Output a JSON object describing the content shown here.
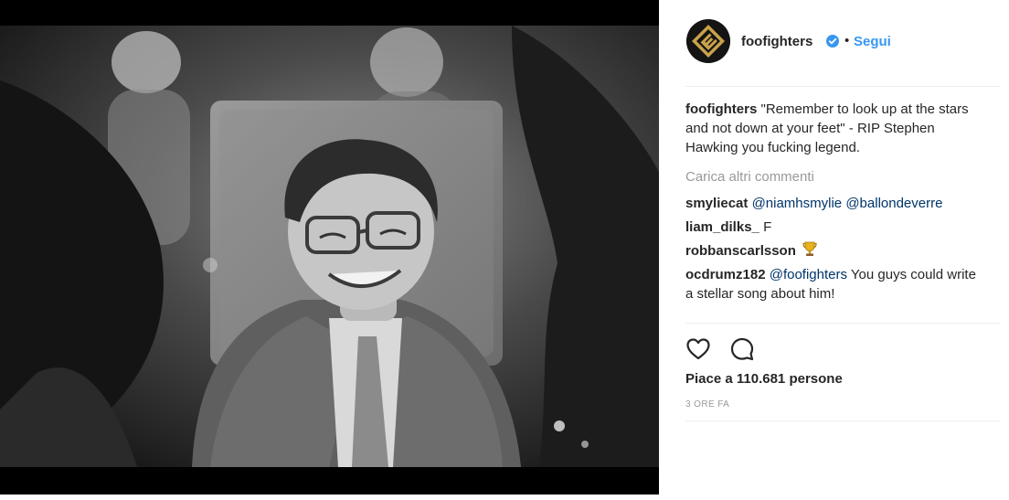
{
  "post": {
    "username": "foofighters",
    "separator": "•",
    "follow_label": "Segui",
    "caption_user": "foofighters",
    "caption_text": " \"Remember to look up at the stars and not down at your feet\" - RIP Stephen Hawking you fucking legend.",
    "load_more": "Carica altri commenti",
    "comments": [
      {
        "user": "smyliecat",
        "mentions": [
          "@niamhsmylie",
          "@ballondeverre"
        ],
        "text": ""
      },
      {
        "user": "liam_dilks_",
        "mentions": [],
        "text": "F"
      },
      {
        "user": "robbanscarlsson",
        "mentions": [],
        "text": "",
        "emoji": "trophy-icon"
      },
      {
        "user": "ocdrumz182",
        "mentions": [
          "@foofighters"
        ],
        "text": "You guys could write a stellar song about him!"
      }
    ],
    "likes_text": "Piace a 110.681 persone",
    "time_text": "3 ORE FA"
  },
  "colors": {
    "link": "#3897f0",
    "mention": "#003569",
    "muted": "#999999",
    "text": "#262626",
    "verified": "#3897f0"
  }
}
